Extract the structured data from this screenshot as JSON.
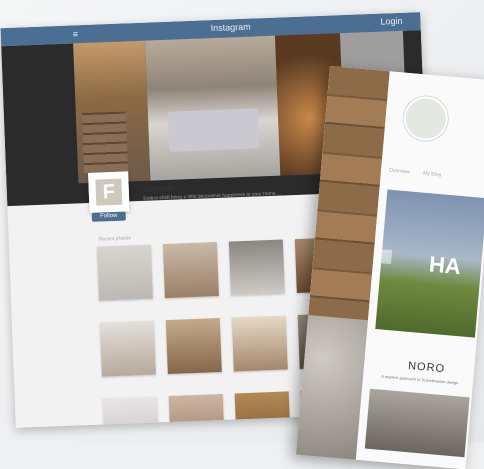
{
  "back_screen": {
    "topbar": {
      "menu_icon": "≡",
      "title": "Instagram",
      "user": "Login"
    },
    "profile": {
      "username": "fargonia",
      "bio": "Stobra shall bring a little decorative happiness to your home ...",
      "follow_label": "Follow"
    },
    "section_label": "Recent photos",
    "grid_count": 12
  },
  "front_screen": {
    "nav": [
      "Overview",
      "My Blog"
    ],
    "banner_text": "HA",
    "caption_title": "NORO",
    "caption_sub": "A modern approach to Scandinavian design"
  }
}
